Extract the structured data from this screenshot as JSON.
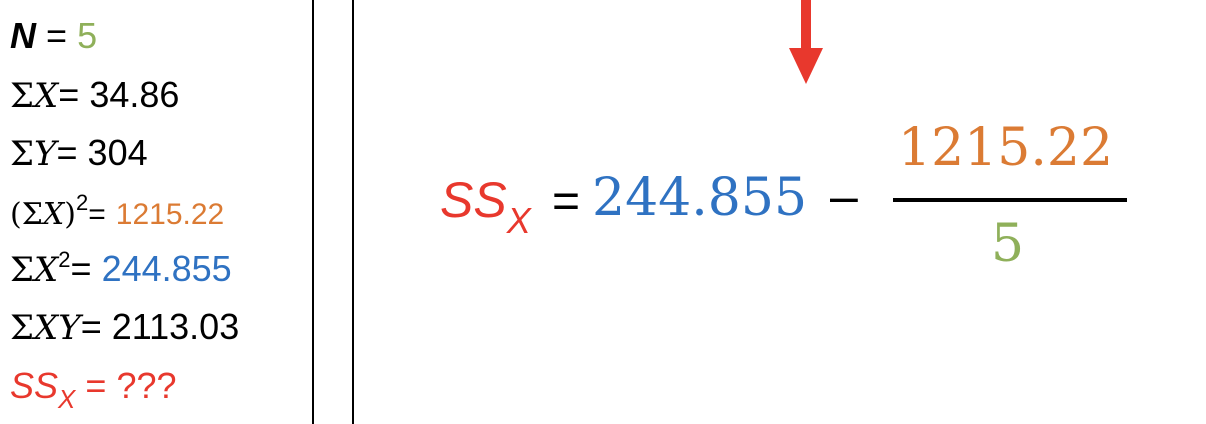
{
  "colors": {
    "red": "#e8382d",
    "green": "#8fb05a",
    "orange": "#db7b34",
    "blue": "#2f72c2",
    "black": "#000000"
  },
  "stats": {
    "n": {
      "label": "N",
      "op": "=",
      "value": "5"
    },
    "sum_x": {
      "sigma": "Σ",
      "var": "X",
      "op": "=",
      "value": "34.86"
    },
    "sum_y": {
      "sigma": "Σ",
      "var": "Y",
      "op": "=",
      "value": "304"
    },
    "sum_x_squared": {
      "open": "(Σ",
      "var": "X",
      "close": ")",
      "power": "2",
      "op": "=",
      "value": "1215.22"
    },
    "sum_of_x2": {
      "sigma": "Σ",
      "var": "X",
      "power": "2",
      "op": "=",
      "value": "244.855"
    },
    "sum_xy": {
      "sigma": "Σ",
      "var": "XY",
      "op": "=",
      "value": "2113.03"
    },
    "ss_x": {
      "label": "SS",
      "subscript": "X",
      "op": "=",
      "value": "???"
    }
  },
  "equation": {
    "lhs": "SS",
    "lhs_subscript": "X",
    "equals": "=",
    "sum_of_squares": "244.855",
    "minus": "–",
    "numerator": "1215.22",
    "denominator": "5"
  },
  "arrow": {
    "icon": "down-arrow-icon",
    "color": "#e8382d"
  }
}
